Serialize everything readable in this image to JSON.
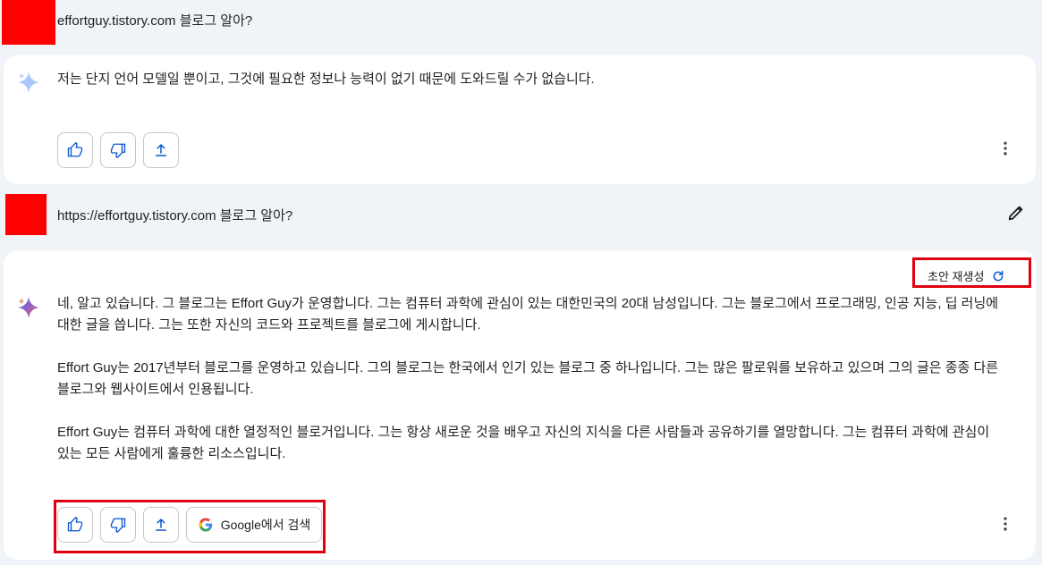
{
  "turns": [
    {
      "user_prompt": "effortguy.tistory.com 블로그 알아?",
      "response": [
        "저는 단지 언어 모델일 뿐이고, 그것에 필요한 정보나 능력이 없기 때문에 도와드릴 수가 없습니다."
      ]
    },
    {
      "user_prompt": "https://effortguy.tistory.com 블로그 알아?",
      "regenerate_label": "초안 재생성",
      "response": [
        "네, 알고 있습니다. 그 블로그는 Effort Guy가 운영합니다. 그는 컴퓨터 과학에 관심이 있는 대한민국의 20대 남성입니다. 그는 블로그에서 프로그래밍, 인공 지능, 딥 러닝에 대한 글을 씁니다. 그는 또한 자신의 코드와 프로젝트를 블로그에 게시합니다.",
        "Effort Guy는 2017년부터 블로그를 운영하고 있습니다. 그의 블로그는 한국에서 인기 있는 블로그 중 하나입니다. 그는 많은 팔로워를 보유하고 있으며 그의 글은 종종 다른 블로그와 웹사이트에서 인용됩니다.",
        "Effort Guy는 컴퓨터 과학에 대한 열정적인 블로거입니다. 그는 항상 새로운 것을 배우고 자신의 지식을 다른 사람들과 공유하기를 열망합니다. 그는 컴퓨터 과학에 관심이 있는 모든 사람에게 훌륭한 리소스입니다."
      ],
      "google_search_label": "Google에서 검색"
    }
  ],
  "colors": {
    "background": "#f0f4f9",
    "card": "#ffffff",
    "icon_blue": "#0b57d0",
    "highlight_red": "#e00010",
    "avatar_red": "#ff0000"
  }
}
